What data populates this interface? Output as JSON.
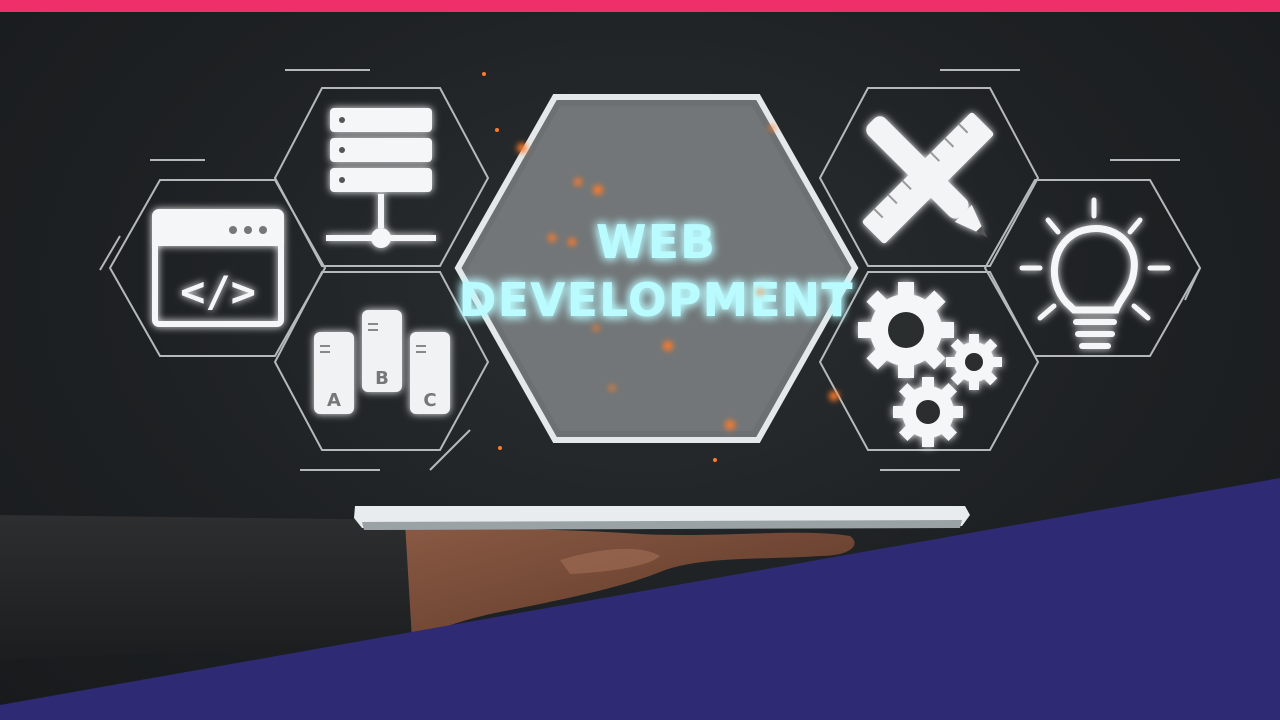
{
  "banner": {
    "title_line1": "WEB",
    "title_line2": "DEVELOPMENT",
    "accent_color": "#ee2f6a",
    "band_color": "#2e2a73",
    "glow_color": "#38e6ff"
  },
  "icons": {
    "left": [
      "code-window-icon",
      "server-network-icon",
      "abc-database-icon"
    ],
    "right": [
      "pencil-ruler-icon",
      "gears-icon",
      "lightbulb-icon"
    ]
  },
  "abc_labels": [
    "A",
    "B",
    "C"
  ]
}
